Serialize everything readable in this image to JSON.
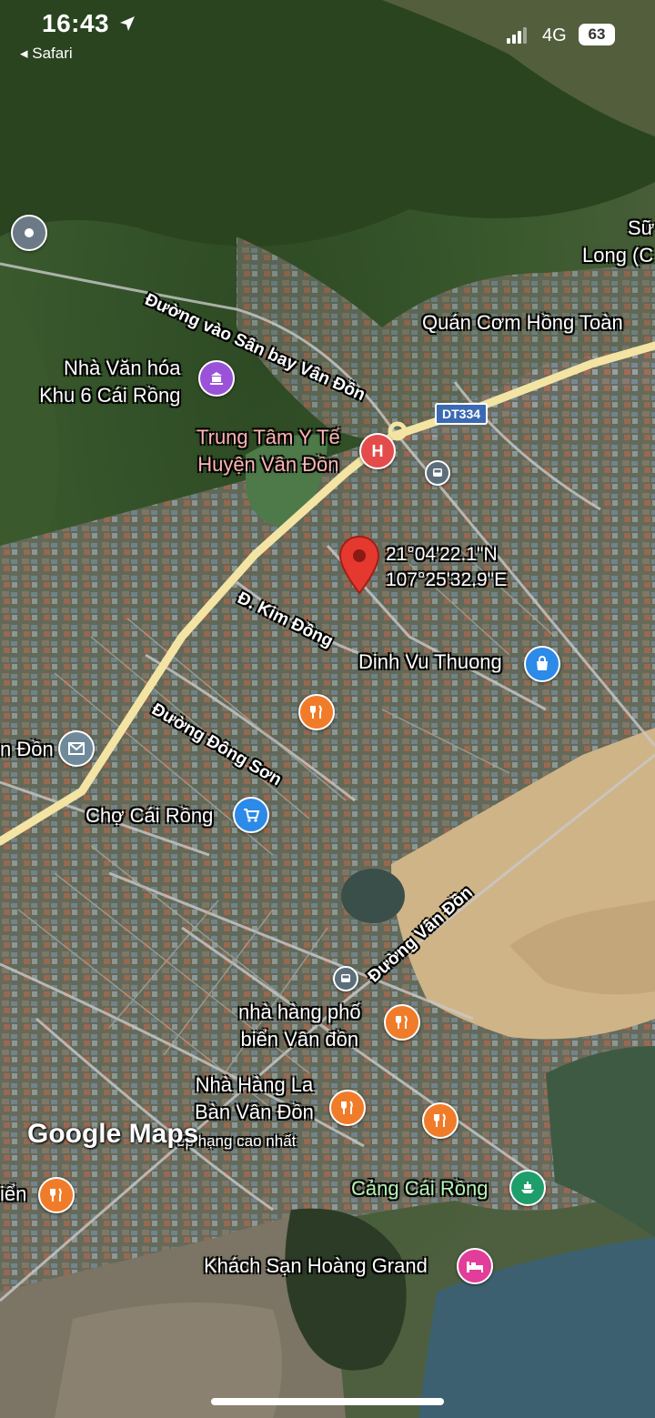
{
  "status_bar": {
    "time": "16:43",
    "back_label": "◂ Safari",
    "network": "4G",
    "battery": "63"
  },
  "map": {
    "coordinates": {
      "lat": "21°04'22.1\"N",
      "lng": "107°25'32.9\"E"
    },
    "places": {
      "nha_van_hoa_1": "Nhà Văn hóa",
      "nha_van_hoa_2": "Khu 6 Cái Rồng",
      "trung_tam_1": "Trung Tâm Y Tế",
      "trung_tam_2": "Huyện Vân Đồn",
      "quan_com": "Quán Cơm Hồng Toàn",
      "su_1": "Sữ",
      "su_2": "Long (C",
      "dinh_vu": "Dinh Vu Thuong",
      "buu_dien": "n Đồn",
      "cho": "Chợ Cái Rồng",
      "nha_hang_pho_1": "nhà hàng phố",
      "nha_hang_pho_2": "biển Vân đồn",
      "nha_hang_la_1": "Nhà Hàng La",
      "nha_hang_la_2": "Bàn Vân Đồn",
      "xep_hang": "ếp hạng cao nhất",
      "bien_left": "iển",
      "cang": "Cảng Cái Rồng",
      "khach_san": "Khách Sạn Hoàng Grand"
    },
    "roads": {
      "san_bay": "Đường vào Sân bay Vân Đồn",
      "kim_dong": "Đ. Kim Đồng",
      "dong_son": "Đường Đông Sơn",
      "van_don": "Đường Vân Đồn",
      "dt334": "DT334"
    },
    "brand": "Google Maps",
    "colors": {
      "red_pin": "#e5392f",
      "hospital": "#e44b4b",
      "restaurant": "#f07c2a",
      "shop": "#2c8ae8",
      "worship": "#9a53d8",
      "port": "#1e9e6a",
      "hotel": "#e23d9a",
      "post": "#6f8a9b",
      "main_road": "#f3e4a4"
    }
  }
}
